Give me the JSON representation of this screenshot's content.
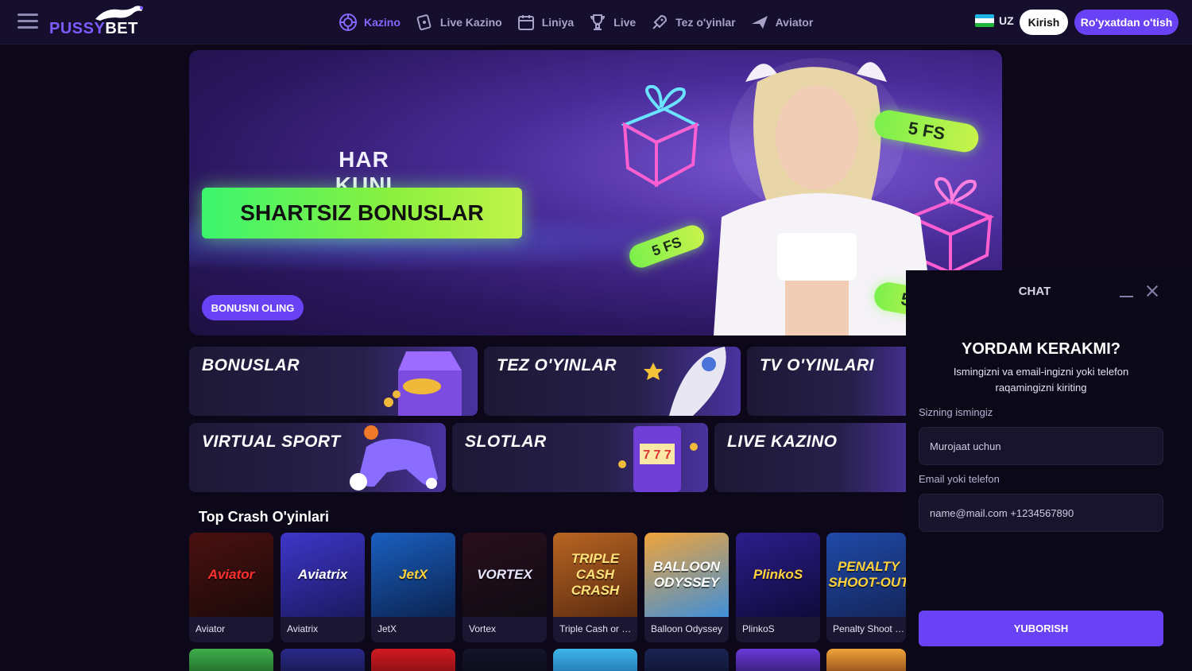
{
  "header": {
    "logo_part1": "PUSSY",
    "logo_part2": "BET",
    "nav": [
      {
        "label": "Kazino",
        "icon": "casino-chip-icon",
        "active": true
      },
      {
        "label": "Live Kazino",
        "icon": "live-casino-icon"
      },
      {
        "label": "Liniya",
        "icon": "calendar-icon"
      },
      {
        "label": "Live",
        "icon": "trophy-icon"
      },
      {
        "label": "Tez o'yinlar",
        "icon": "rocket-icon"
      },
      {
        "label": "Aviator",
        "icon": "plane-icon"
      }
    ],
    "language": "UZ",
    "login_label": "Kirish",
    "register_label": "Ro'yxatdan o'tish"
  },
  "banner": {
    "title": "HAR KUNI",
    "cta": "SHARTSIZ BONUSLAR",
    "button": "BONUSNI OLING",
    "pill_1": "5 FS",
    "pill_2": "5 FS",
    "pill_3": "5"
  },
  "categories": [
    {
      "label": "BONUSLAR"
    },
    {
      "label": "TEZ O'YINLAR"
    },
    {
      "label": "TV O'YINLARI"
    },
    {
      "label": "VIRTUAL SPORT"
    },
    {
      "label": "SLOTLAR"
    },
    {
      "label": "LIVE KAZINO"
    }
  ],
  "crash_section": {
    "title": "Top Crash O'yinlari",
    "games": [
      {
        "name": "Aviator",
        "thumb": "Aviator",
        "color_a": "#4a1010",
        "color_b": "#1c0a0a",
        "text_color": "#ff3030"
      },
      {
        "name": "Aviatrix",
        "thumb": "Aviatrix",
        "color_a": "#3e36c9",
        "color_b": "#1b1960",
        "text_color": "#ffffff"
      },
      {
        "name": "JetX",
        "thumb": "JetX",
        "color_a": "#1a5fc0",
        "color_b": "#0b2350",
        "text_color": "#ffd43a"
      },
      {
        "name": "Vortex",
        "thumb": "VORTEX",
        "color_a": "#2a0f1d",
        "color_b": "#0e0b12",
        "text_color": "#e6e6ff"
      },
      {
        "name": "Triple Cash or Crash",
        "thumb": "TRIPLE CASH CRASH",
        "color_a": "#b86522",
        "color_b": "#5a2a10",
        "text_color": "#ffe27a"
      },
      {
        "name": "Balloon Odyssey",
        "thumb": "BALLOON ODYSSEY",
        "color_a": "#f0a43a",
        "color_b": "#3f8fd9",
        "text_color": "#ffffff"
      },
      {
        "name": "PlinkoS",
        "thumb": "PlinkoS",
        "color_a": "#2d1d8c",
        "color_b": "#0f0b3a",
        "text_color": "#ffd23a"
      },
      {
        "name": "Penalty Shoot Out",
        "thumb": "PENALTY SHOOT-OUT",
        "color_a": "#1f4aa8",
        "color_b": "#14255a",
        "text_color": "#ffd23a"
      }
    ]
  },
  "chat": {
    "title": "CHAT",
    "heading": "YORDAM KERAKMI?",
    "subtitle": "Ismingizni va email-ingizni yoki telefon raqamingizni kiriting",
    "name_label": "Sizning ismingiz",
    "name_placeholder": "Murojaat uchun",
    "contact_label": "Email yoki telefon",
    "contact_placeholder": "name@mail.com +1234567890",
    "send_label": "YUBORISH"
  },
  "colors": {
    "accent": "#6a42f5",
    "active_nav": "#8567ff",
    "cta_green": "#7af04c"
  }
}
